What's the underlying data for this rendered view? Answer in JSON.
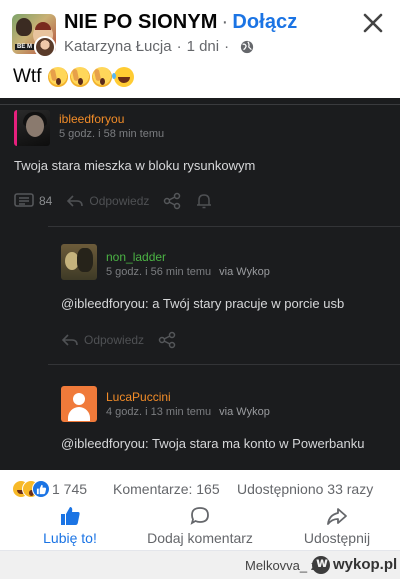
{
  "post": {
    "group_name": "NIE PO SIONYM",
    "join_label": "Dołącz",
    "dot": "·",
    "author": "Katarzyna Łucja",
    "time": "1 dni",
    "text": "Wtf",
    "avatar_tag": "BE M",
    "icons": {
      "close": "close-icon",
      "globe": "globe-icon",
      "emojis": [
        "face-screaming-emoji",
        "face-screaming-emoji",
        "face-screaming-emoji",
        "tears-of-joy-emoji"
      ]
    }
  },
  "embed": {
    "comments": [
      {
        "username": "ibleedforyou",
        "time": "5 godz. i 58 min temu",
        "via": "",
        "text": "Twoja stara mieszka w bloku rysunkowym",
        "count": "84",
        "reply_label": "Odpowiedz",
        "name_color": "#f28c28"
      },
      {
        "username": "non_ladder",
        "time": "5 godz. i 56 min temu",
        "via": "via Wykop",
        "text": "@ibleedforyou: a Twój stary pracuje w porcie usb",
        "reply_label": "Odpowiedz",
        "name_color": "#4bb344"
      },
      {
        "username": "LucaPuccini",
        "time": "4 godz. i 13 min temu",
        "via": "via Wykop",
        "text": "@ibleedforyou: Twoja stara ma konto w Powerbanku",
        "name_color": "#f28c28"
      }
    ],
    "background": "#1b1c1e"
  },
  "footer": {
    "reactions_count": "1 745",
    "comments": "Komentarze: 165",
    "shares": "Udostępniono 33 razy",
    "actions": {
      "like": "Lubię to!",
      "comment": "Dodaj komentarz",
      "share": "Udostępnij"
    },
    "accent": "#1b74e4"
  },
  "watermark": {
    "user": "Melkovva_ z",
    "site": "wykop.pl"
  }
}
